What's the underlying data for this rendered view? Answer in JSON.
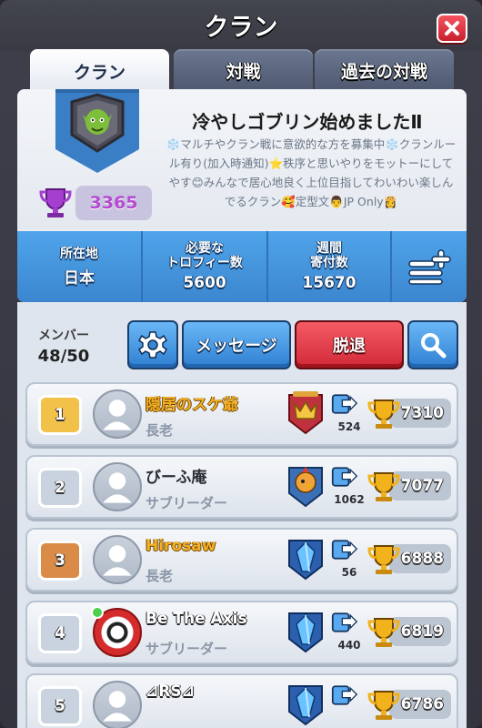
{
  "header": {
    "title": "クラン"
  },
  "tabs": [
    {
      "label": "クラン",
      "active": true
    },
    {
      "label": "対戦",
      "active": false
    },
    {
      "label": "過去の対戦",
      "active": false
    }
  ],
  "clan": {
    "name": "冷やしゴブリン始めましたⅡ",
    "description": "❄️マルチやクラン戦に意欲的な方を募集中❄️クランルール有り(加入時通知)⭐秩序と思いやりをモットーにしてやす😊みんなで居心地良く上位目指してわいわい楽しんでるクラン🥰定型文👨JP Only👸",
    "trophies": "3365",
    "badge_icon": "goblin-shield-icon"
  },
  "stats": {
    "location_label": "所在地",
    "location_value": "日本",
    "required_label": "必要な\nトロフィー数",
    "required_value": "5600",
    "donations_label": "週間\n寄付数",
    "donations_value": "15670"
  },
  "members": {
    "label": "メンバー",
    "count": "48/50",
    "settings_icon": "gear-icon",
    "message_label": "メッセージ",
    "leave_label": "脱退",
    "search_icon": "magnifier-icon",
    "list": [
      {
        "rank": "1",
        "name": "隠居のスケ爺",
        "role": "長老",
        "donations": "524",
        "trophies": "7310",
        "rank_color": "#f2c14a",
        "name_style": "gold",
        "arena": "crown-arena"
      },
      {
        "rank": "2",
        "name": "びーふ庵",
        "role": "サブリーダー",
        "donations": "1062",
        "trophies": "7077",
        "rank_color": "#c9d3df",
        "name_style": "dark",
        "arena": "chicken-arena"
      },
      {
        "rank": "3",
        "name": "Hirosaw",
        "role": "長老",
        "donations": "56",
        "trophies": "6888",
        "rank_color": "#d98b47",
        "name_style": "gold",
        "arena": "crystal-arena"
      },
      {
        "rank": "4",
        "name": "Be The Axis",
        "role": "サブリーダー",
        "donations": "440",
        "trophies": "6819",
        "rank_color": "#c9d3df",
        "name_style": "white",
        "arena": "crystal-arena"
      },
      {
        "rank": "5",
        "name": "⊿RS⊿",
        "role": "",
        "donations": "",
        "trophies": "6786",
        "rank_color": "#c9d3df",
        "name_style": "white",
        "arena": "crystal-arena"
      }
    ]
  },
  "colors": {
    "accent_blue": "#3b86cf",
    "leave_red": "#d22838",
    "gold_name": "#f3b126",
    "trophy_purple": "#b34bd0"
  }
}
